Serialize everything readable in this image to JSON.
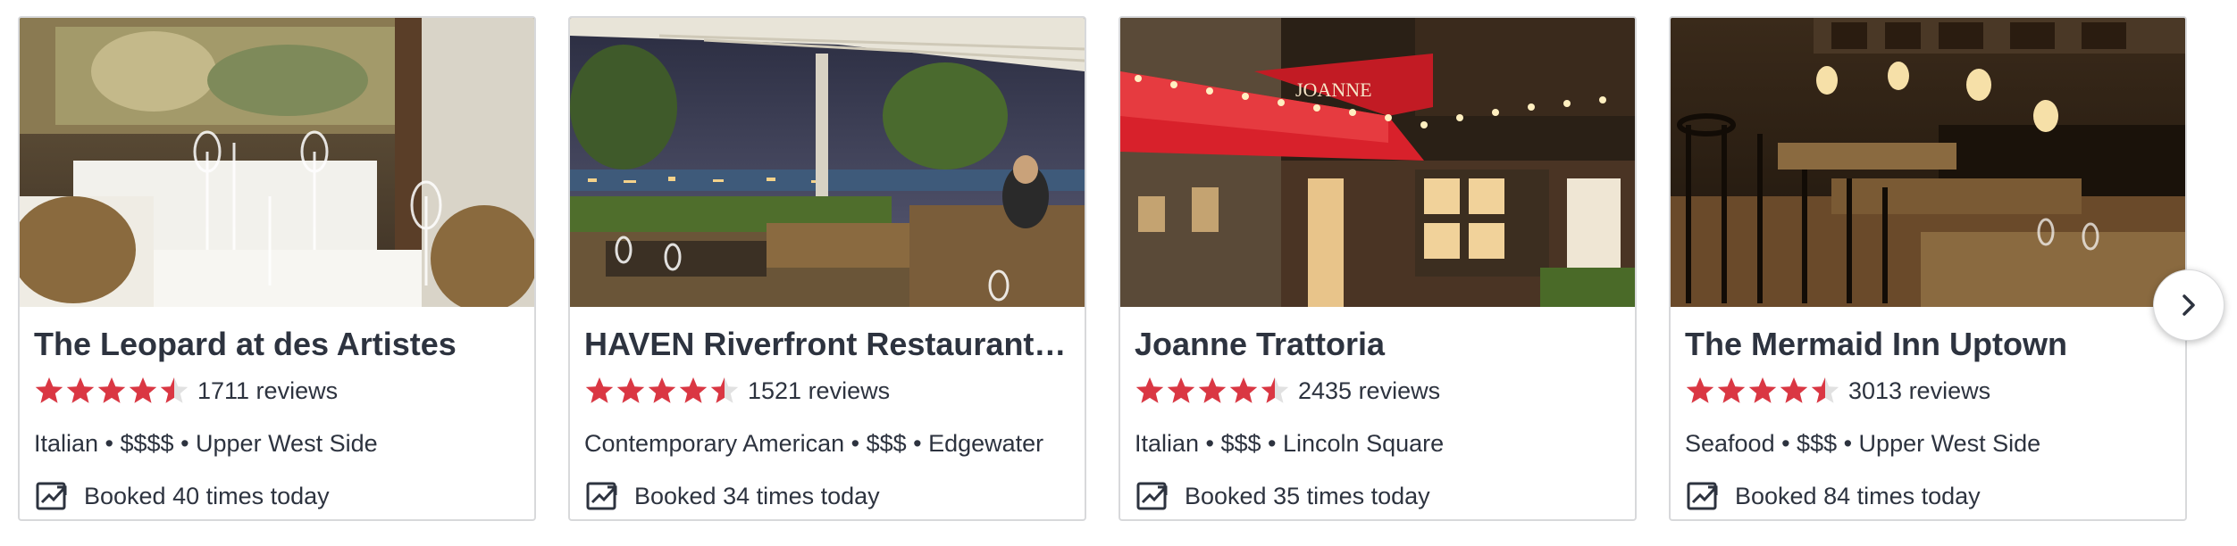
{
  "restaurants": [
    {
      "name": "The Leopard at des Artistes",
      "rating": 4.5,
      "reviews": "1711 reviews",
      "cuisine": "Italian",
      "price": "$$$$",
      "neighborhood": "Upper West Side",
      "meta": "Italian • $$$$ • Upper West Side",
      "booked": "Booked 40 times today",
      "photo": "elegant-dining-room-mural"
    },
    {
      "name": "HAVEN Riverfront Restaurant an...",
      "rating": 4.5,
      "reviews": "1521 reviews",
      "cuisine": "Contemporary American",
      "price": "$$$",
      "neighborhood": "Edgewater",
      "meta": "Contemporary American • $$$ • Edgewater",
      "booked": "Booked 34 times today",
      "photo": "riverfront-terrace-city-skyline"
    },
    {
      "name": "Joanne Trattoria",
      "rating": 4.5,
      "reviews": "2435 reviews",
      "cuisine": "Italian",
      "price": "$$$",
      "neighborhood": "Lincoln Square",
      "meta": "Italian • $$$ • Lincoln Square",
      "booked": "Booked 35 times today",
      "photo": "red-awning-storefront-night",
      "awning_text": "JOANNE"
    },
    {
      "name": "The Mermaid Inn Uptown",
      "rating": 4.5,
      "reviews": "3013 reviews",
      "cuisine": "Seafood",
      "price": "$$$",
      "neighborhood": "Upper West Side",
      "meta": "Seafood • $$$ • Upper West Side",
      "booked": "Booked 84 times today",
      "photo": "dark-wood-dining-room-sconces"
    }
  ],
  "star_icon": "star-icon",
  "trend_icon": "trending-up-icon",
  "next_icon": "chevron-right-icon",
  "colors": {
    "star": "#da3743",
    "star_empty": "#e1e1e1",
    "text": "#2d333f",
    "border": "#d8d9db"
  }
}
